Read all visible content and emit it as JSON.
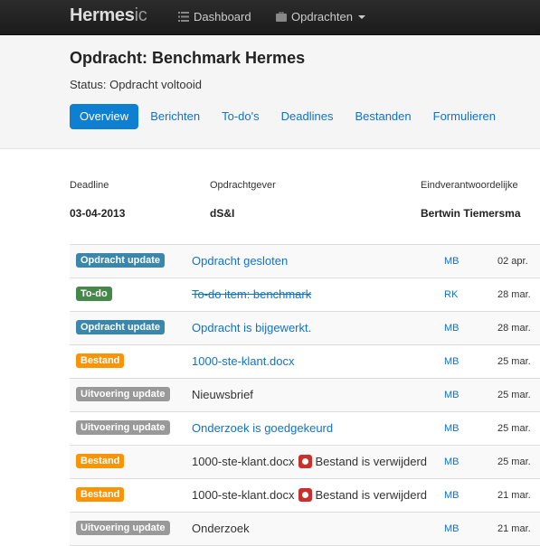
{
  "navbar": {
    "brand": "Hermes",
    "brand_suffix": "ic",
    "items": [
      {
        "label": "Dashboard",
        "icon": "list-icon"
      },
      {
        "label": "Opdrachten",
        "icon": "briefcase-icon"
      }
    ]
  },
  "page": {
    "title": "Opdracht: Benchmark Hermes",
    "status": "Status: Opdracht voltooid"
  },
  "tabs": [
    {
      "label": "Overview"
    },
    {
      "label": "Berichten"
    },
    {
      "label": "To-do's"
    },
    {
      "label": "Deadlines"
    },
    {
      "label": "Bestanden"
    },
    {
      "label": "Formulieren"
    }
  ],
  "meta": {
    "deadline_label": "Deadline",
    "deadline_value": "03-04-2013",
    "client_label": "Opdrachtgever",
    "client_value": "dS&I",
    "owner_label": "Eindverantwoordelijke",
    "owner_value": "Bertwin Tiemersma"
  },
  "activity": [
    {
      "badge": "Opdracht update",
      "title": "Opdracht gesloten",
      "extra": "",
      "user": "MB",
      "date": "02 apr."
    },
    {
      "badge": "To-do",
      "title": "To-do item: benchmark",
      "extra": "",
      "user": "RK",
      "date": "28 mar."
    },
    {
      "badge": "Opdracht update",
      "title": "Opdracht is bijgewerkt.",
      "extra": "",
      "user": "MB",
      "date": "28 mar."
    },
    {
      "badge": "Bestand",
      "title": "1000-ste-klant.docx",
      "extra": "",
      "user": "MB",
      "date": "25 mar."
    },
    {
      "badge": "Uitvoering update",
      "title": "Nieuwsbrief",
      "extra": "",
      "user": "MB",
      "date": "25 mar."
    },
    {
      "badge": "Uitvoering update",
      "title": "Onderzoek is goedgekeurd",
      "extra": "",
      "user": "MB",
      "date": "25 mar."
    },
    {
      "badge": "Bestand",
      "title": "1000-ste-klant.docx",
      "extra": "Bestand is verwijderd",
      "user": "MB",
      "date": "25 mar."
    },
    {
      "badge": "Bestand",
      "title": "1000-ste-klant.docx",
      "extra": "Bestand is verwijderd",
      "user": "MB",
      "date": "21 mar."
    },
    {
      "badge": "Uitvoering update",
      "title": "Onderzoek",
      "extra": "",
      "user": "MB",
      "date": "21 mar."
    }
  ],
  "colors": {
    "link": "#0f73c8",
    "badge_blue": "#3a87ad",
    "badge_green": "#46884b",
    "badge_orange": "#f89406",
    "badge_gray": "#999999",
    "delete_red": "#c9302c"
  }
}
